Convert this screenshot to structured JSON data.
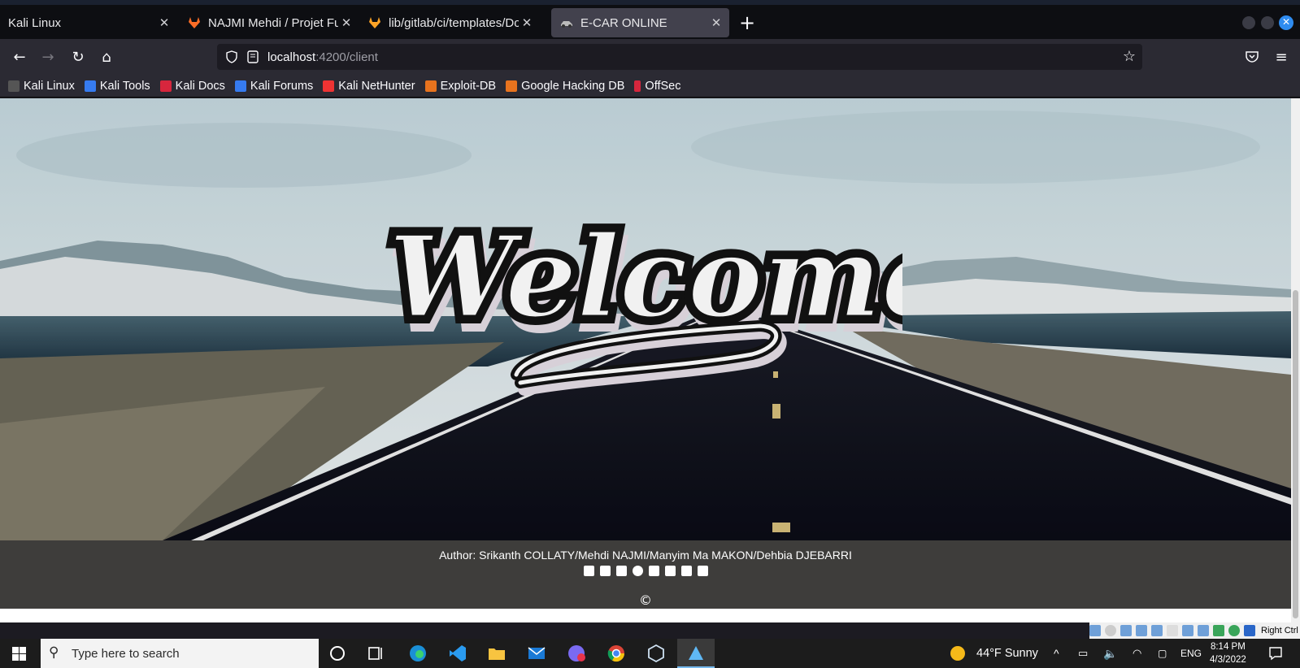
{
  "browser": {
    "tabs": [
      {
        "title": "Kali Linux",
        "active": false
      },
      {
        "title": "NAJMI Mehdi / Projet Full",
        "active": false
      },
      {
        "title": "lib/gitlab/ci/templates/Do",
        "active": false
      },
      {
        "title": "E-CAR ONLINE",
        "active": true
      }
    ],
    "url_host": "localhost",
    "url_path": ":4200/client",
    "bookmarks": [
      "Kali Linux",
      "Kali Tools",
      "Kali Docs",
      "Kali Forums",
      "Kali NetHunter",
      "Exploit-DB",
      "Google Hacking DB",
      "OffSec"
    ]
  },
  "page": {
    "hero_title": "Welcome",
    "authors": "Author: Srikanth COLLATY/Mehdi NAJMI/Manyim Ma MAKON/Dehbia DJEBARRI",
    "social_icons": [
      "facebook-icon",
      "instagram-icon",
      "linkedin-icon",
      "github-icon",
      "google-plus-icon",
      "twitter-icon",
      "youtube-icon",
      "stackoverflow-icon"
    ],
    "copyright": "©"
  },
  "vm": {
    "host_key": "Right Ctrl"
  },
  "taskbar": {
    "search_placeholder": "Type here to search",
    "weather": "44°F  Sunny",
    "language": "ENG",
    "time": "8:14 PM",
    "date": "4/3/2022"
  }
}
